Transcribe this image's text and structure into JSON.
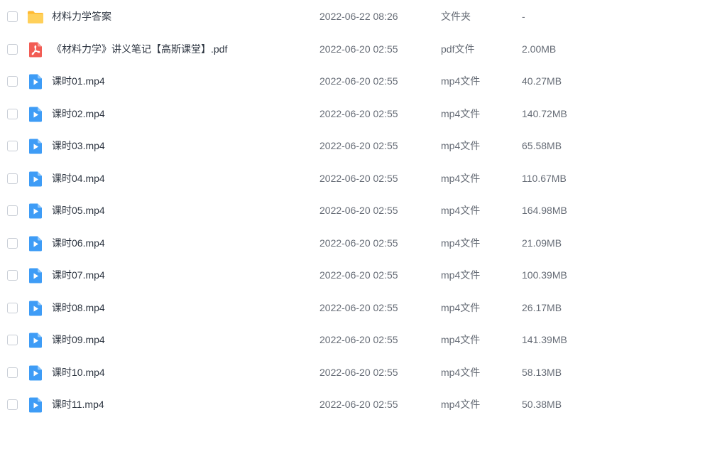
{
  "colors": {
    "folder": "#ffc94a",
    "pdf": "#f25c54",
    "video": "#3e9cf6"
  },
  "files": [
    {
      "icon": "folder-icon",
      "name": "材料力学答案",
      "date": "2022-06-22 08:26",
      "type": "文件夹",
      "size": "-"
    },
    {
      "icon": "pdf-icon",
      "name": "《材料力学》讲义笔记【高斯课堂】.pdf",
      "date": "2022-06-20 02:55",
      "type": "pdf文件",
      "size": "2.00MB"
    },
    {
      "icon": "video-file-icon",
      "name": "课时01.mp4",
      "date": "2022-06-20 02:55",
      "type": "mp4文件",
      "size": "40.27MB"
    },
    {
      "icon": "video-file-icon",
      "name": "课时02.mp4",
      "date": "2022-06-20 02:55",
      "type": "mp4文件",
      "size": "140.72MB"
    },
    {
      "icon": "video-file-icon",
      "name": "课时03.mp4",
      "date": "2022-06-20 02:55",
      "type": "mp4文件",
      "size": "65.58MB"
    },
    {
      "icon": "video-file-icon",
      "name": "课时04.mp4",
      "date": "2022-06-20 02:55",
      "type": "mp4文件",
      "size": "110.67MB"
    },
    {
      "icon": "video-file-icon",
      "name": "课时05.mp4",
      "date": "2022-06-20 02:55",
      "type": "mp4文件",
      "size": "164.98MB"
    },
    {
      "icon": "video-file-icon",
      "name": "课时06.mp4",
      "date": "2022-06-20 02:55",
      "type": "mp4文件",
      "size": "21.09MB"
    },
    {
      "icon": "video-file-icon",
      "name": "课时07.mp4",
      "date": "2022-06-20 02:55",
      "type": "mp4文件",
      "size": "100.39MB"
    },
    {
      "icon": "video-file-icon",
      "name": "课时08.mp4",
      "date": "2022-06-20 02:55",
      "type": "mp4文件",
      "size": "26.17MB"
    },
    {
      "icon": "video-file-icon",
      "name": "课时09.mp4",
      "date": "2022-06-20 02:55",
      "type": "mp4文件",
      "size": "141.39MB"
    },
    {
      "icon": "video-file-icon",
      "name": "课时10.mp4",
      "date": "2022-06-20 02:55",
      "type": "mp4文件",
      "size": "58.13MB"
    },
    {
      "icon": "video-file-icon",
      "name": "课时11.mp4",
      "date": "2022-06-20 02:55",
      "type": "mp4文件",
      "size": "50.38MB"
    }
  ]
}
